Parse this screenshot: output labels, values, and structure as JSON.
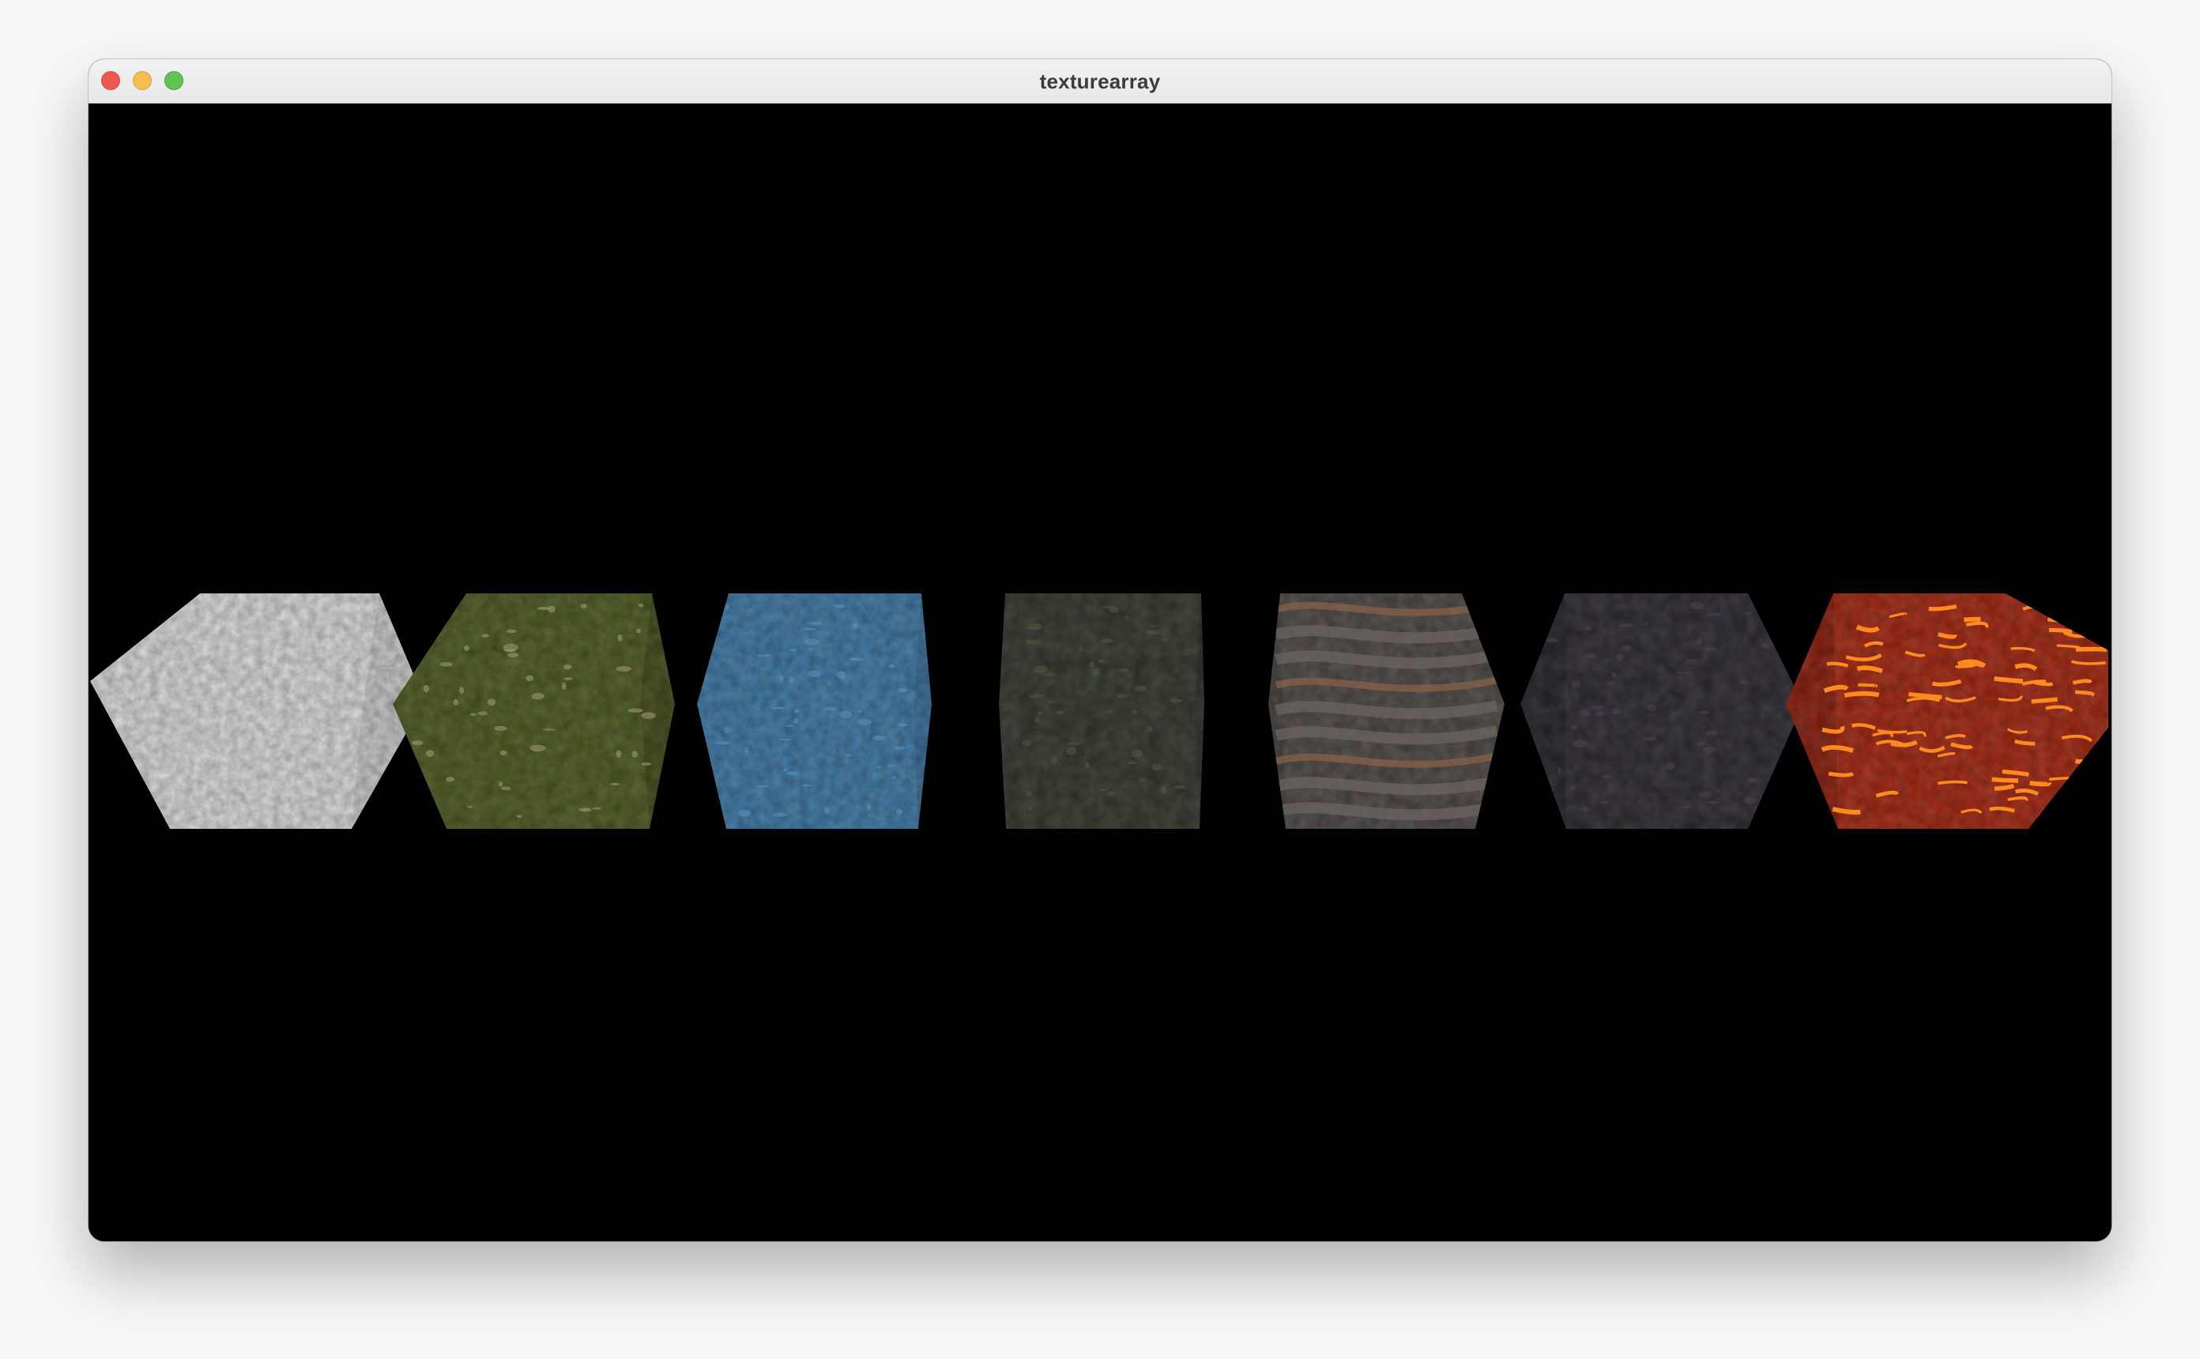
{
  "window": {
    "title": "texturearray"
  },
  "scene": {
    "description_label": "",
    "cubes": [
      {
        "texture": "snow",
        "colors": {
          "front": "#dcdcdc",
          "side": "#c9c9c9",
          "top": "#e8e8e8",
          "speck": "#b8b8b8"
        }
      },
      {
        "texture": "grass",
        "colors": {
          "front": "#4c5a1f",
          "side": "#3f4a17",
          "top": "#56652a",
          "speck": "#a89c7a"
        }
      },
      {
        "texture": "water",
        "colors": {
          "front": "#3c78a6",
          "side": "#346b96",
          "top": "#4682b0",
          "speck": "#5a94c0"
        }
      },
      {
        "texture": "mossy-stone",
        "colors": {
          "front": "#33362c",
          "side": "#2b2e26",
          "top": "#3a3d33",
          "speck": "#4e5a3a"
        }
      },
      {
        "texture": "rock-strata",
        "colors": {
          "front": "#4d4744",
          "side": "#433e3b",
          "top": "#57514d",
          "speck": "#8a6248"
        }
      },
      {
        "texture": "gravel",
        "colors": {
          "front": "#2c2830",
          "side": "#25222a",
          "top": "#332f37",
          "speck": "#4a4452"
        }
      },
      {
        "texture": "lava",
        "colors": {
          "front": "#a3240e",
          "side": "#8a1c0a",
          "top": "#b52c10",
          "speck": "#ff8a1e"
        }
      }
    ]
  }
}
